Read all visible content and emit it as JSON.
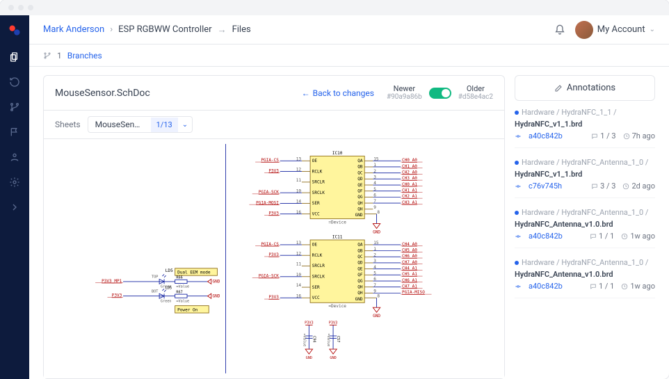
{
  "breadcrumbs": {
    "user": "Mark Anderson",
    "project": "ESP RGBWW Controller",
    "page": "Files"
  },
  "account": {
    "label": "My Account"
  },
  "branches": {
    "count": "1",
    "label": "Branches"
  },
  "document": {
    "title": "MouseSensor.SchDoc",
    "back_label": "Back to changes",
    "newer": {
      "label": "Newer",
      "hash": "#90a9a86b"
    },
    "older": {
      "label": "Older",
      "hash": "#d58e4ac2"
    }
  },
  "sheets": {
    "label": "Sheets",
    "name": "MouseSens…",
    "page": "1/13"
  },
  "annotations": {
    "title": "Annotations",
    "items": [
      {
        "path": "Hardware / HydraNFC_1_1 /",
        "file": "HydraNFC_v1_1.brd",
        "hash": "a40c842b",
        "count": "1 / 3",
        "time": "7h ago"
      },
      {
        "path": "Hardware / HydraNFC_Antenna_1_0 /",
        "file": "HydraNFC_v1_1.brd",
        "hash": "c76v745h",
        "count": "3 / 3",
        "time": "2d ago"
      },
      {
        "path": "Hardware / HydraNFC_Antenna_1_0 /",
        "file": "HydraNFC_Antenna_v1.0.brd",
        "hash": "a40c842b",
        "count": "1 / 1",
        "time": "1w ago"
      },
      {
        "path": "Hardware / HydraNFC_Antenna_1_0 /",
        "file": "HydraNFC_Antenna_v1.0.brd",
        "hash": "a40c842b",
        "count": "1 / 1",
        "time": "1w ago"
      }
    ]
  },
  "schematic": {
    "ic10": {
      "ref": "IC10",
      "left_pins": [
        {
          "n": "13",
          "name": "OE"
        },
        {
          "n": "12",
          "name": "RCLK"
        },
        {
          "n": "11",
          "name": "SRCLR"
        },
        {
          "n": "10",
          "name": "SRCLK"
        },
        {
          "n": "14",
          "name": "SER"
        },
        {
          "n": "16",
          "name": "VCC"
        }
      ],
      "right_pins": [
        {
          "n": "15",
          "name": "QA"
        },
        {
          "n": "1",
          "name": "QB"
        },
        {
          "n": "2",
          "name": "QC"
        },
        {
          "n": "3",
          "name": "QD"
        },
        {
          "n": "4",
          "name": "QE"
        },
        {
          "n": "5",
          "name": "QF"
        },
        {
          "n": "6",
          "name": "QG"
        },
        {
          "n": "7",
          "name": "QH"
        },
        {
          "n": "9",
          "name": "QH"
        }
      ],
      "bottom_right_pin": {
        "n": "8",
        "name": "GND"
      },
      "right_nets": [
        "CH0_A0",
        "CH1_A0",
        "CH2_A0",
        "CH3_A0",
        "CH0_A1",
        "CH1_A1",
        "CH2_A1",
        "CH3_A1"
      ],
      "left_nets": [
        "PGIA-CS",
        "P3V3",
        "",
        "PGIA-SCK",
        "PGIA-MOSI",
        "P3V3"
      ],
      "device": "=Device",
      "gnd_label": "GND"
    },
    "ic11": {
      "ref": "IC11",
      "left_pins": [
        {
          "n": "13",
          "name": "OE"
        },
        {
          "n": "12",
          "name": "RCLK"
        },
        {
          "n": "11",
          "name": "SRCLR"
        },
        {
          "n": "10",
          "name": "SRCLK"
        },
        {
          "n": "14",
          "name": "SER"
        },
        {
          "n": "16",
          "name": "VCC"
        }
      ],
      "right_pins": [
        {
          "n": "15",
          "name": "QA"
        },
        {
          "n": "1",
          "name": "QB"
        },
        {
          "n": "2",
          "name": "QC"
        },
        {
          "n": "3",
          "name": "QD"
        },
        {
          "n": "4",
          "name": "QE"
        },
        {
          "n": "5",
          "name": "QF"
        },
        {
          "n": "6",
          "name": "QG"
        },
        {
          "n": "7",
          "name": "QH"
        },
        {
          "n": "9",
          "name": "QH"
        }
      ],
      "bottom_right_pin": {
        "n": "8",
        "name": "GND"
      },
      "right_nets": [
        "CH4_A0",
        "CH5_A0",
        "CH6_A0",
        "CH7_A0",
        "CH4_A1",
        "CH5_A1",
        "CH6_A1",
        "CH7_A1",
        "PGIA-MISO"
      ],
      "left_nets": [
        "PGIA-CS",
        "P3V3",
        "",
        "PGIA-SCK",
        "",
        "P3V3"
      ],
      "device": "=Device",
      "gnd_label": "GND"
    },
    "tags": {
      "dual_eem": "Dual EEM mode",
      "power_on": "Power On"
    },
    "leds": {
      "ld5": "LD5",
      "top": "TOP",
      "bot": "BOT",
      "r66": "R66",
      "r67": "R67",
      "val": "=Value",
      "green": "Green"
    },
    "pwr_nets": {
      "p3v3_mp1": "P3V3_MP1",
      "p3v3": "P3V3",
      "gnd": "GND"
    },
    "caps": {
      "c94": "C94",
      "c57": "C57",
      "val": "=Value",
      "p3v3": "P3V3",
      "gnd": "GND"
    }
  }
}
